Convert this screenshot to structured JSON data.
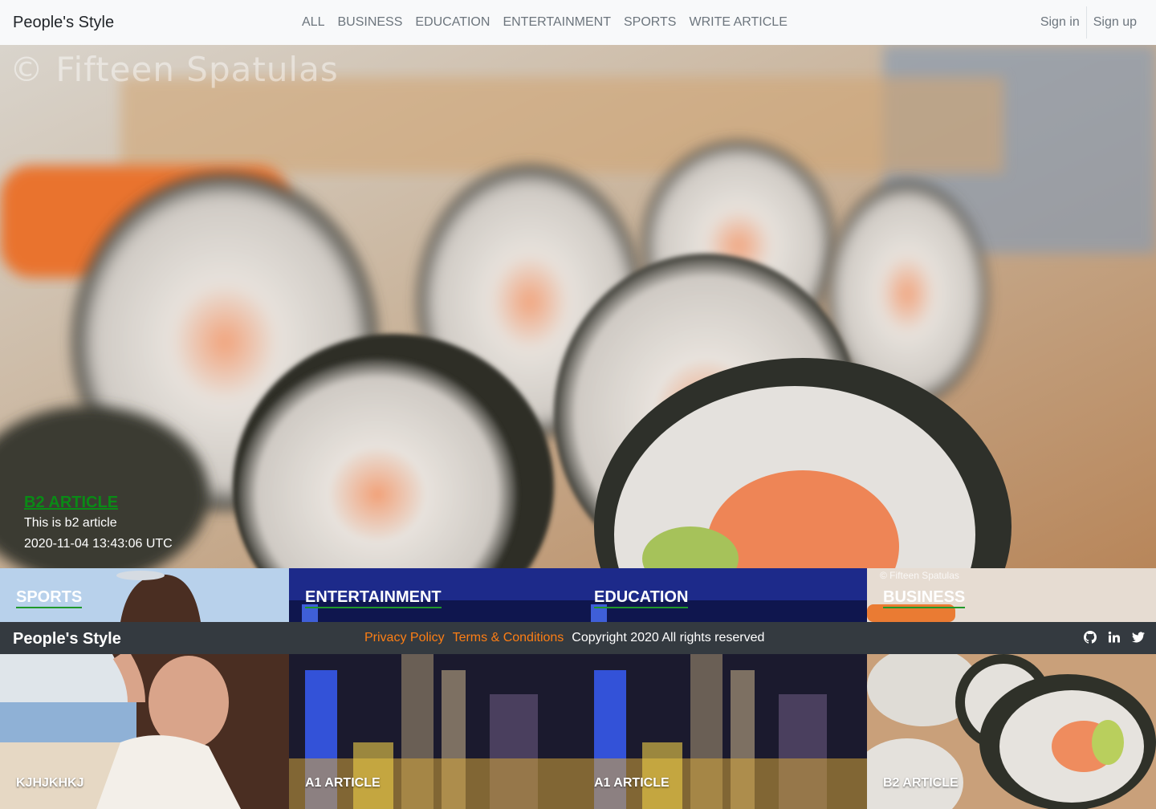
{
  "navbar": {
    "brand": "People's Style",
    "links": [
      "ALL",
      "BUSINESS",
      "EDUCATION",
      "ENTERTAINMENT",
      "SPORTS",
      "WRITE ARTICLE"
    ],
    "sign_in": "Sign in",
    "sign_up": "Sign up"
  },
  "hero": {
    "watermark": "© Fifteen Spatulas",
    "category": "B2 ARTICLE",
    "text": "This is b2 article",
    "date": "2020-11-04 13:43:06 UTC"
  },
  "categories": [
    {
      "name": "SPORTS",
      "article": "KJHJKHKJ"
    },
    {
      "name": "ENTERTAINMENT",
      "article": "A1 ARTICLE"
    },
    {
      "name": "EDUCATION",
      "article": "A1 ARTICLE"
    },
    {
      "name": "BUSINESS",
      "article": "B2 ARTICLE",
      "watermark": "© Fifteen Spatulas"
    }
  ],
  "footer": {
    "brand": "People's Style",
    "privacy": "Privacy Policy",
    "terms": "Terms & Conditions",
    "copyright": "Copyright 2020 All rights reserved"
  },
  "icons": {
    "github": "github-icon",
    "linkedin": "linkedin-icon",
    "twitter": "twitter-icon"
  },
  "colors": {
    "accent_orange": "#fd7e14",
    "category_green": "#0a8a16",
    "footer_bg": "#343a40",
    "navbar_bg": "#f8f9fa"
  }
}
